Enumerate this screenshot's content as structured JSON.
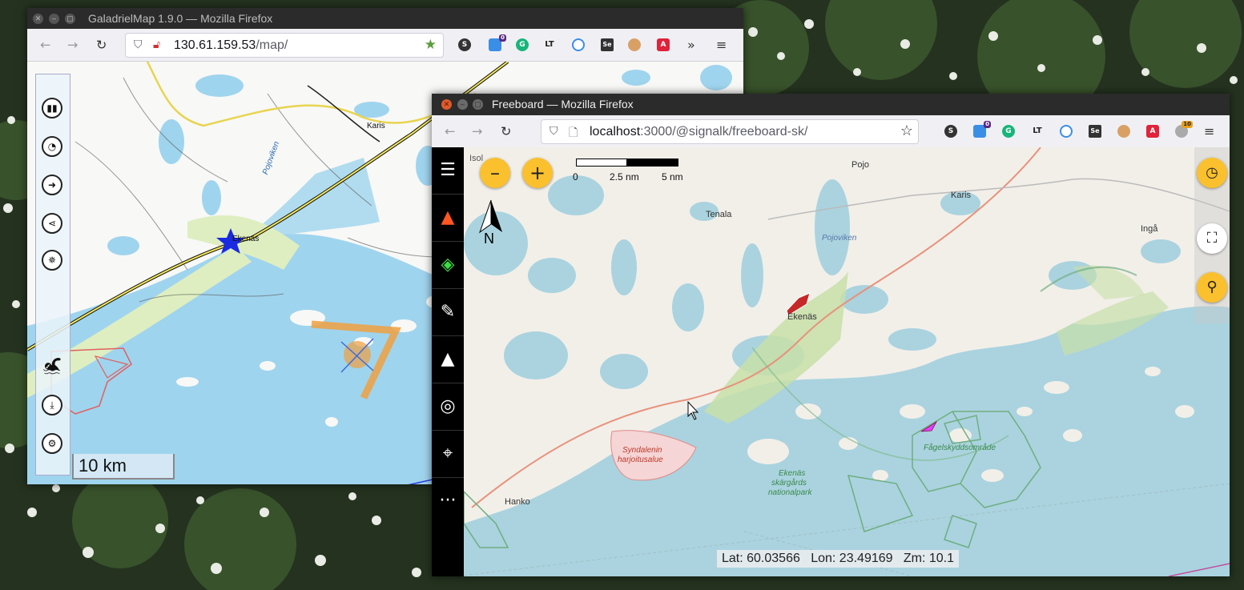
{
  "galadriel": {
    "window_title": "GaladrielMap 1.9.0 — Mozilla Firefox",
    "url_host": "130.61.159.53",
    "url_path": "/map/",
    "scale_label": "10 km",
    "map_labels": {
      "karis": "Karis",
      "ekenas": "Ekenäs",
      "pojoviken": "Pojoviken"
    },
    "tools": [
      {
        "icon": "layers-icon"
      },
      {
        "icon": "dashboard-icon"
      },
      {
        "icon": "route-icon"
      },
      {
        "icon": "share-icon"
      },
      {
        "icon": "compass-icon"
      },
      {
        "icon": "swimmer-icon"
      },
      {
        "icon": "download-icon"
      },
      {
        "icon": "settings-icon"
      }
    ],
    "extension_badge": "0"
  },
  "freeboard": {
    "window_title": "Freeboard — Mozilla Firefox",
    "url_host": "localhost",
    "url_path": ":3000/@signalk/freeboard-sk/",
    "scale": {
      "t0": "0",
      "t1": "2.5 nm",
      "t2": "5 nm"
    },
    "north_label": "N",
    "map_labels": {
      "isol": "Isol",
      "pojo": "Pojo",
      "karis": "Karis",
      "tenala": "Tenala",
      "pojoviken": "Pojoviken",
      "inga": "Ingå",
      "ekenas": "Ekenäs",
      "syndalenin": "Syndalenin",
      "harjoitusalue": "harjoitusalue",
      "hanko": "Hanko",
      "ekenas2": "Ekenäs",
      "skargards": "skärgårds",
      "nationalpark": "nationalpark",
      "fagel": "Fågelskyddsområde"
    },
    "status": {
      "lat": "Lat: 60.03566",
      "lon": "Lon: 23.49169",
      "zm": "Zm: 10.1"
    },
    "extension_badges": {
      "notif": "0",
      "count": "10"
    }
  },
  "colors": {
    "water": "#aad3df",
    "land": "#f2efe9",
    "forest": "#c8dfa8",
    "topo_land": "#f8f8f6",
    "topo_water": "#9fd4ee",
    "accent_yellow": "#fbc02d"
  }
}
